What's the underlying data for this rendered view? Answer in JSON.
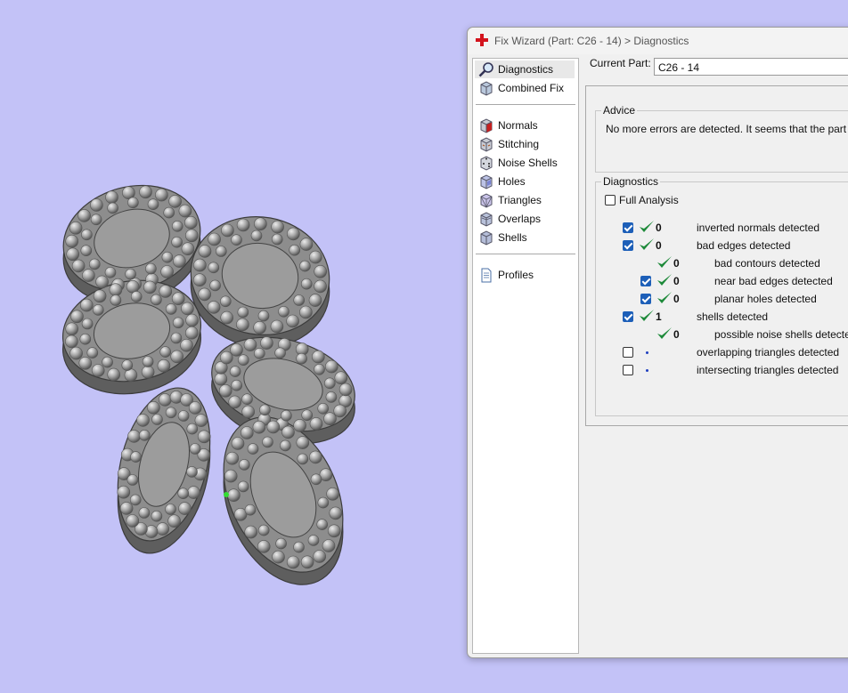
{
  "window": {
    "title": "Fix Wizard (Part: C26 - 14) > Diagnostics"
  },
  "sidebar": {
    "items": [
      {
        "label": "Diagnostics",
        "icon": "magnifier-icon"
      },
      {
        "label": "Combined Fix",
        "icon": "cube-icon"
      },
      {
        "label": "Normals",
        "icon": "normals-cube-icon"
      },
      {
        "label": "Stitching",
        "icon": "stitching-cube-icon"
      },
      {
        "label": "Noise Shells",
        "icon": "dice-icon"
      },
      {
        "label": "Holes",
        "icon": "holes-cube-icon"
      },
      {
        "label": "Triangles",
        "icon": "triangles-cube-icon"
      },
      {
        "label": "Overlaps",
        "icon": "overlaps-cube-icon"
      },
      {
        "label": "Shells",
        "icon": "shells-cube-icon"
      },
      {
        "label": "Profiles",
        "icon": "document-icon"
      }
    ]
  },
  "part": {
    "label": "Current Part:",
    "value": "C26 - 14"
  },
  "advice": {
    "title": "Advice",
    "text": "No more errors are detected. It seems that the part is ok"
  },
  "diagnostics": {
    "title": "Diagnostics",
    "full_analysis": "Full Analysis",
    "rows": [
      {
        "checked": true,
        "status": "ok",
        "count": "0",
        "label": "inverted normals detected"
      },
      {
        "checked": true,
        "status": "ok",
        "count": "0",
        "label": "bad edges detected"
      },
      {
        "checked": null,
        "status": "ok",
        "count": "0",
        "label": "bad contours detected"
      },
      {
        "checked": true,
        "status": "ok",
        "count": "0",
        "label": "near bad edges detected"
      },
      {
        "checked": true,
        "status": "ok",
        "count": "0",
        "label": "planar holes detected"
      },
      {
        "checked": true,
        "status": "ok",
        "count": "1",
        "label": "shells detected"
      },
      {
        "checked": null,
        "status": "ok",
        "count": "0",
        "label": "possible noise shells detected"
      },
      {
        "checked": false,
        "status": "pending",
        "count": "",
        "label": "overlapping triangles detected"
      },
      {
        "checked": false,
        "status": "pending",
        "count": "",
        "label": "intersecting triangles detected"
      }
    ]
  },
  "colors": {
    "background": "#c3c2f7",
    "checkbox": "#1d5fb8",
    "tick": "#1e8a3a",
    "app_icon": "#d3131d"
  }
}
